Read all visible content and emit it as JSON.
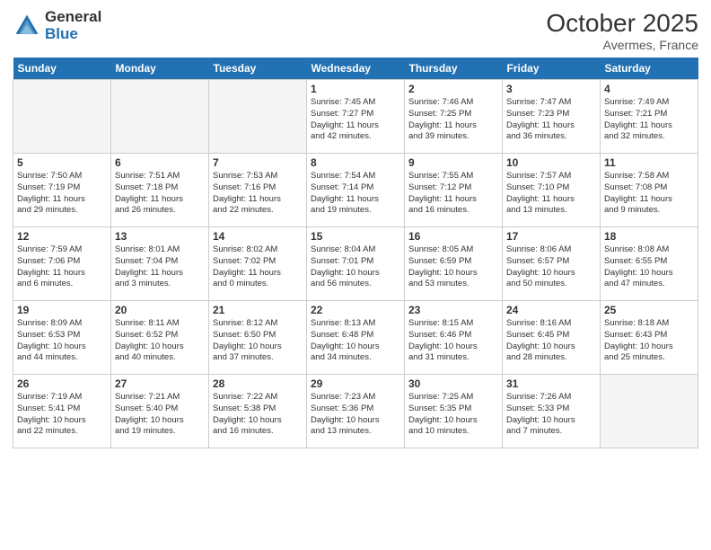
{
  "header": {
    "logo_general": "General",
    "logo_blue": "Blue",
    "month": "October 2025",
    "location": "Avermes, France"
  },
  "days_of_week": [
    "Sunday",
    "Monday",
    "Tuesday",
    "Wednesday",
    "Thursday",
    "Friday",
    "Saturday"
  ],
  "weeks": [
    [
      {
        "day": "",
        "info": ""
      },
      {
        "day": "",
        "info": ""
      },
      {
        "day": "",
        "info": ""
      },
      {
        "day": "1",
        "info": "Sunrise: 7:45 AM\nSunset: 7:27 PM\nDaylight: 11 hours\nand 42 minutes."
      },
      {
        "day": "2",
        "info": "Sunrise: 7:46 AM\nSunset: 7:25 PM\nDaylight: 11 hours\nand 39 minutes."
      },
      {
        "day": "3",
        "info": "Sunrise: 7:47 AM\nSunset: 7:23 PM\nDaylight: 11 hours\nand 36 minutes."
      },
      {
        "day": "4",
        "info": "Sunrise: 7:49 AM\nSunset: 7:21 PM\nDaylight: 11 hours\nand 32 minutes."
      }
    ],
    [
      {
        "day": "5",
        "info": "Sunrise: 7:50 AM\nSunset: 7:19 PM\nDaylight: 11 hours\nand 29 minutes."
      },
      {
        "day": "6",
        "info": "Sunrise: 7:51 AM\nSunset: 7:18 PM\nDaylight: 11 hours\nand 26 minutes."
      },
      {
        "day": "7",
        "info": "Sunrise: 7:53 AM\nSunset: 7:16 PM\nDaylight: 11 hours\nand 22 minutes."
      },
      {
        "day": "8",
        "info": "Sunrise: 7:54 AM\nSunset: 7:14 PM\nDaylight: 11 hours\nand 19 minutes."
      },
      {
        "day": "9",
        "info": "Sunrise: 7:55 AM\nSunset: 7:12 PM\nDaylight: 11 hours\nand 16 minutes."
      },
      {
        "day": "10",
        "info": "Sunrise: 7:57 AM\nSunset: 7:10 PM\nDaylight: 11 hours\nand 13 minutes."
      },
      {
        "day": "11",
        "info": "Sunrise: 7:58 AM\nSunset: 7:08 PM\nDaylight: 11 hours\nand 9 minutes."
      }
    ],
    [
      {
        "day": "12",
        "info": "Sunrise: 7:59 AM\nSunset: 7:06 PM\nDaylight: 11 hours\nand 6 minutes."
      },
      {
        "day": "13",
        "info": "Sunrise: 8:01 AM\nSunset: 7:04 PM\nDaylight: 11 hours\nand 3 minutes."
      },
      {
        "day": "14",
        "info": "Sunrise: 8:02 AM\nSunset: 7:02 PM\nDaylight: 11 hours\nand 0 minutes."
      },
      {
        "day": "15",
        "info": "Sunrise: 8:04 AM\nSunset: 7:01 PM\nDaylight: 10 hours\nand 56 minutes."
      },
      {
        "day": "16",
        "info": "Sunrise: 8:05 AM\nSunset: 6:59 PM\nDaylight: 10 hours\nand 53 minutes."
      },
      {
        "day": "17",
        "info": "Sunrise: 8:06 AM\nSunset: 6:57 PM\nDaylight: 10 hours\nand 50 minutes."
      },
      {
        "day": "18",
        "info": "Sunrise: 8:08 AM\nSunset: 6:55 PM\nDaylight: 10 hours\nand 47 minutes."
      }
    ],
    [
      {
        "day": "19",
        "info": "Sunrise: 8:09 AM\nSunset: 6:53 PM\nDaylight: 10 hours\nand 44 minutes."
      },
      {
        "day": "20",
        "info": "Sunrise: 8:11 AM\nSunset: 6:52 PM\nDaylight: 10 hours\nand 40 minutes."
      },
      {
        "day": "21",
        "info": "Sunrise: 8:12 AM\nSunset: 6:50 PM\nDaylight: 10 hours\nand 37 minutes."
      },
      {
        "day": "22",
        "info": "Sunrise: 8:13 AM\nSunset: 6:48 PM\nDaylight: 10 hours\nand 34 minutes."
      },
      {
        "day": "23",
        "info": "Sunrise: 8:15 AM\nSunset: 6:46 PM\nDaylight: 10 hours\nand 31 minutes."
      },
      {
        "day": "24",
        "info": "Sunrise: 8:16 AM\nSunset: 6:45 PM\nDaylight: 10 hours\nand 28 minutes."
      },
      {
        "day": "25",
        "info": "Sunrise: 8:18 AM\nSunset: 6:43 PM\nDaylight: 10 hours\nand 25 minutes."
      }
    ],
    [
      {
        "day": "26",
        "info": "Sunrise: 7:19 AM\nSunset: 5:41 PM\nDaylight: 10 hours\nand 22 minutes."
      },
      {
        "day": "27",
        "info": "Sunrise: 7:21 AM\nSunset: 5:40 PM\nDaylight: 10 hours\nand 19 minutes."
      },
      {
        "day": "28",
        "info": "Sunrise: 7:22 AM\nSunset: 5:38 PM\nDaylight: 10 hours\nand 16 minutes."
      },
      {
        "day": "29",
        "info": "Sunrise: 7:23 AM\nSunset: 5:36 PM\nDaylight: 10 hours\nand 13 minutes."
      },
      {
        "day": "30",
        "info": "Sunrise: 7:25 AM\nSunset: 5:35 PM\nDaylight: 10 hours\nand 10 minutes."
      },
      {
        "day": "31",
        "info": "Sunrise: 7:26 AM\nSunset: 5:33 PM\nDaylight: 10 hours\nand 7 minutes."
      },
      {
        "day": "",
        "info": ""
      }
    ]
  ]
}
